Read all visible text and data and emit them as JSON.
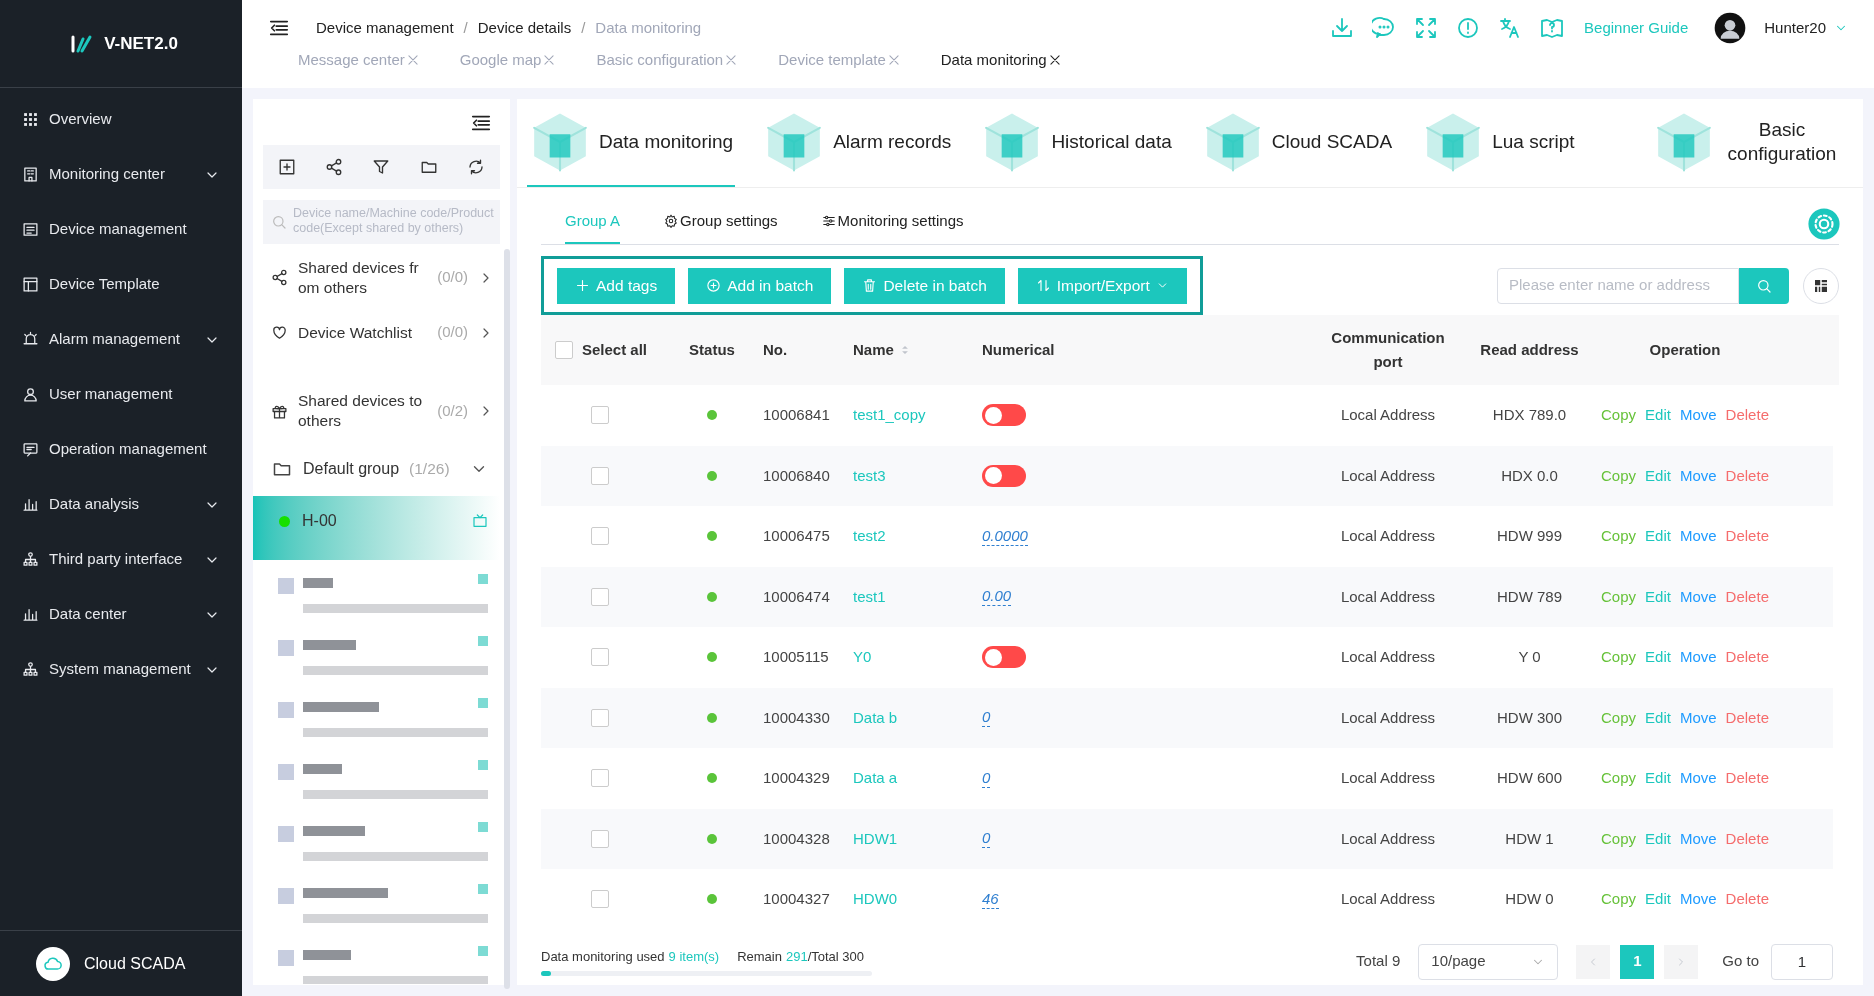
{
  "logo": {
    "text": "V-NET2.0"
  },
  "sidebar": {
    "items": [
      {
        "label": "Overview",
        "has_submenu": false
      },
      {
        "label": "Monitoring center",
        "has_submenu": true
      },
      {
        "label": "Device management",
        "has_submenu": false
      },
      {
        "label": "Device Template",
        "has_submenu": false
      },
      {
        "label": "Alarm management",
        "has_submenu": true
      },
      {
        "label": "User management",
        "has_submenu": false
      },
      {
        "label": "Operation management",
        "has_submenu": false
      },
      {
        "label": "Data analysis",
        "has_submenu": true
      },
      {
        "label": "Third party interface",
        "has_submenu": true
      },
      {
        "label": "Data center",
        "has_submenu": true
      },
      {
        "label": "System management",
        "has_submenu": true
      }
    ],
    "footer": "Cloud SCADA"
  },
  "breadcrumb": [
    {
      "label": "Device management",
      "current": false
    },
    {
      "separator": "/",
      "label": "Device details",
      "current": false
    },
    {
      "separator": "/",
      "label": "Data monitoring",
      "current": true
    }
  ],
  "page_tabs": [
    {
      "label": "Message center",
      "selected": false
    },
    {
      "label": "Google map",
      "selected": false
    },
    {
      "label": "Basic configuration",
      "selected": false
    },
    {
      "label": "Device template",
      "selected": false
    },
    {
      "label": "Data monitoring",
      "selected": true
    }
  ],
  "header": {
    "guide": "Beginner Guide",
    "user": "Hunter20"
  },
  "device_panel": {
    "search_placeholder": "Device name/Machine code/Product code(Except shared by others)",
    "groups": [
      {
        "kind": "share",
        "label": "Shared devices from others",
        "count": "(0/0)"
      },
      {
        "kind": "heart",
        "label": "Device Watchlist",
        "count": "(0/0)"
      },
      {
        "kind": "gift",
        "label": "Shared devices to others",
        "count": "(0/2)"
      }
    ],
    "default_group": {
      "label": "Default group",
      "count": "(1/26)",
      "expanded": true
    },
    "device": {
      "name": "H-00",
      "online": true,
      "selected": true
    }
  },
  "feature_tabs": [
    {
      "label": "Data monitoring",
      "selected": true
    },
    {
      "label": "Alarm records",
      "selected": false
    },
    {
      "label": "Historical data",
      "selected": false
    },
    {
      "label": "Cloud SCADA",
      "selected": false
    },
    {
      "label": "Lua script",
      "selected": false
    },
    {
      "label": "Basic configuration",
      "selected": false
    }
  ],
  "sub_tabs": [
    {
      "label": "Group A",
      "selected": true
    },
    {
      "label": "Group settings",
      "selected": false
    },
    {
      "label": "Monitoring settings",
      "selected": false
    }
  ],
  "toolbar": {
    "buttons": [
      "Add tags",
      "Add in batch",
      "Delete in batch",
      "Import/Export"
    ],
    "search_placeholder": "Please enter name or address"
  },
  "table": {
    "select_all_checked": false,
    "columns": [
      "Select all",
      "Status",
      "No.",
      "Name",
      "Numerical",
      "Communication port",
      "Read address",
      "Operation"
    ],
    "rows": [
      {
        "checked": false,
        "online": true,
        "no": "10006841",
        "name": "test1_copy",
        "kind": "switch",
        "on": false,
        "port": "Local Address",
        "address": "HDX 789.0",
        "actions": [
          "Copy",
          "Edit",
          "Move",
          "Delete"
        ]
      },
      {
        "checked": false,
        "online": true,
        "no": "10006840",
        "name": "test3",
        "kind": "switch",
        "on": false,
        "port": "Local Address",
        "address": "HDX 0.0",
        "actions": [
          "Copy",
          "Edit",
          "Move",
          "Delete"
        ]
      },
      {
        "checked": false,
        "online": true,
        "no": "10006475",
        "name": "test2",
        "kind": "value",
        "value": "0.0000",
        "port": "Local Address",
        "address": "HDW 999",
        "actions": [
          "Copy",
          "Edit",
          "Move",
          "Delete"
        ]
      },
      {
        "checked": false,
        "online": true,
        "no": "10006474",
        "name": "test1",
        "kind": "value",
        "value": "0.00",
        "port": "Local Address",
        "address": "HDW 789",
        "actions": [
          "Copy",
          "Edit",
          "Move",
          "Delete"
        ]
      },
      {
        "checked": false,
        "online": true,
        "no": "10005115",
        "name": "Y0",
        "kind": "switch",
        "on": false,
        "port": "Local Address",
        "address": "Y 0",
        "actions": [
          "Copy",
          "Edit",
          "Move",
          "Delete"
        ]
      },
      {
        "checked": false,
        "online": true,
        "no": "10004330",
        "name": "Data b",
        "kind": "value",
        "value": "0",
        "port": "Local Address",
        "address": "HDW 300",
        "actions": [
          "Copy",
          "Edit",
          "Move",
          "Delete"
        ]
      },
      {
        "checked": false,
        "online": true,
        "no": "10004329",
        "name": "Data a",
        "kind": "value",
        "value": "0",
        "port": "Local Address",
        "address": "HDW 600",
        "actions": [
          "Copy",
          "Edit",
          "Move",
          "Delete"
        ]
      },
      {
        "checked": false,
        "online": true,
        "no": "10004328",
        "name": "HDW1",
        "kind": "value",
        "value": "0",
        "port": "Local Address",
        "address": "HDW 1",
        "actions": [
          "Copy",
          "Edit",
          "Move",
          "Delete"
        ]
      },
      {
        "checked": false,
        "online": true,
        "no": "10004327",
        "name": "HDW0",
        "kind": "value",
        "value": "46",
        "port": "Local Address",
        "address": "HDW 0",
        "actions": [
          "Copy",
          "Edit",
          "Move",
          "Delete"
        ]
      }
    ]
  },
  "usage": {
    "label": "Data monitoring used",
    "used": "9 item(s)",
    "remain_label": "Remain",
    "remain": "291",
    "total": "/Total 300",
    "level": 0.03
  },
  "pagination": {
    "total": "Total 9",
    "page_size": "10/page",
    "pages": [
      {
        "label": "1",
        "selected": true
      }
    ],
    "goto_label": "Go to",
    "goto_value": "1"
  }
}
